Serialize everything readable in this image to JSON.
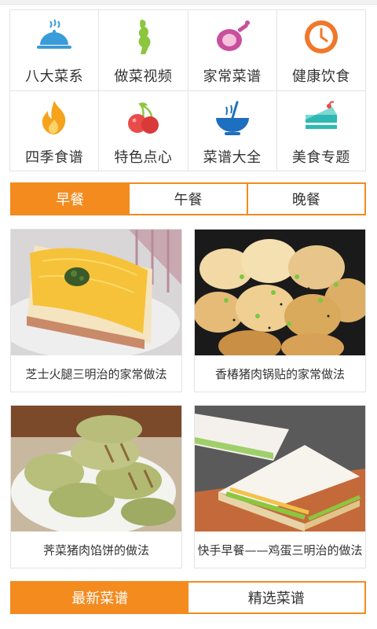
{
  "categories": [
    {
      "label": "八大菜系",
      "icon": "cloche-icon"
    },
    {
      "label": "做菜视频",
      "icon": "figure-icon"
    },
    {
      "label": "家常菜谱",
      "icon": "ham-icon"
    },
    {
      "label": "健康饮食",
      "icon": "clock-icon"
    },
    {
      "label": "四季食谱",
      "icon": "flame-icon"
    },
    {
      "label": "特色点心",
      "icon": "cherry-icon"
    },
    {
      "label": "菜谱大全",
      "icon": "bowl-icon"
    },
    {
      "label": "美食专题",
      "icon": "cake-icon"
    }
  ],
  "meal_tabs": [
    "早餐",
    "午餐",
    "晚餐"
  ],
  "recipes": [
    {
      "title": "芝士火腿三明治的家常做法"
    },
    {
      "title": "香椿猪肉锅贴的家常做法"
    },
    {
      "title": "荠菜猪肉馅饼的做法"
    },
    {
      "title": "快手早餐——鸡蛋三明治的做法"
    }
  ],
  "bottom_tabs": [
    "最新菜谱",
    "精选菜谱"
  ],
  "colors": {
    "accent": "#f38b1f",
    "text": "#333333",
    "border": "#e3e3e3"
  }
}
